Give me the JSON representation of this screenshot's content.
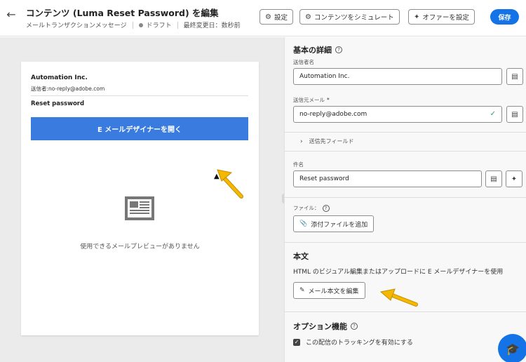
{
  "header": {
    "back_icon": "arrow-left-icon",
    "title": "コンテンツ (Luma Reset Password) を編集",
    "subtitle_type": "メールトランザクションメッセージ",
    "status": "ドラフト",
    "last_modified": "最終変更日：数秒前",
    "buttons": {
      "settings": "設定",
      "simulate": "コンテンツをシミュレート",
      "offer": "オファーを設定"
    },
    "save_label": "保存"
  },
  "preview": {
    "sender_name": "Automation Inc.",
    "sender_line": "送信者:no-reply@adobe.com",
    "subject": "Reset password",
    "open_designer_label": "E メールデザイナーを開く",
    "no_preview_text": "使用できるメールプレビューがありません"
  },
  "details": {
    "title": "基本の詳細",
    "sender_name_label": "送信者名",
    "sender_name_value": "Automation Inc.",
    "sender_email_label": "送信元メール",
    "sender_email_required": "*",
    "sender_email_value": "no-reply@adobe.com",
    "header_fields_label": "送信先フィールド",
    "subject_label": "件名",
    "subject_value": "Reset password",
    "files_label": "ファイル：",
    "add_attachment_label": "添付ファイルを追加"
  },
  "body": {
    "title": "本文",
    "description": "HTML のビジュアル編集またはアップロードに E メールデザイナーを使用",
    "edit_button_label": "メール本文を編集"
  },
  "options": {
    "title": "オプション機能",
    "tracking_label": "この配信のトラッキングを有効にする",
    "tracking_checked": true
  },
  "colors": {
    "accent": "#1473e6",
    "designer_button": "#3a7be0",
    "annotation_arrow": "#f5b800"
  }
}
